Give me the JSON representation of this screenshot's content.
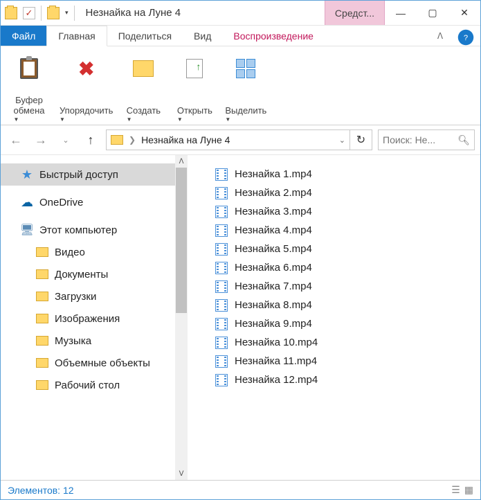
{
  "title": "Незнайка на Луне 4",
  "toolTab": "Средст...",
  "tabs": {
    "file": "Файл",
    "home": "Главная",
    "share": "Поделиться",
    "view": "Вид",
    "playback": "Воспроизведение"
  },
  "ribbon": {
    "clipboard": "Буфер\nобмена",
    "organize": "Упорядочить",
    "new": "Создать",
    "open": "Открыть",
    "select": "Выделить"
  },
  "address": {
    "current": "Незнайка на Луне 4"
  },
  "search": {
    "placeholder": "Поиск: Не..."
  },
  "sidebar": {
    "quick": "Быстрый доступ",
    "onedrive": "OneDrive",
    "thispc": "Этот компьютер",
    "items": [
      "Видео",
      "Документы",
      "Загрузки",
      "Изображения",
      "Музыка",
      "Объемные объекты",
      "Рабочий стол"
    ]
  },
  "files": [
    "Незнайка 1.mp4",
    "Незнайка 2.mp4",
    "Незнайка 3.mp4",
    "Незнайка 4.mp4",
    "Незнайка 5.mp4",
    "Незнайка 6.mp4",
    "Незнайка 7.mp4",
    "Незнайка 8.mp4",
    "Незнайка 9.mp4",
    "Незнайка 10.mp4",
    "Незнайка 11.mp4",
    "Незнайка 12.mp4"
  ],
  "status": {
    "label": "Элементов:",
    "count": "12"
  }
}
